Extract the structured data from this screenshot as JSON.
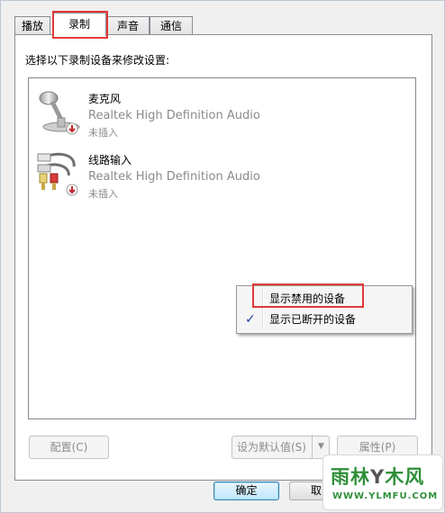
{
  "tabs": [
    {
      "label": "播放"
    },
    {
      "label": "录制"
    },
    {
      "label": "声音"
    },
    {
      "label": "通信"
    }
  ],
  "instruction": "选择以下录制设备来修改设置:",
  "devices": [
    {
      "name": "麦克风",
      "description": "Realtek High Definition Audio",
      "status": "未插入",
      "icon": "microphone-icon"
    },
    {
      "name": "线路输入",
      "description": "Realtek High Definition Audio",
      "status": "未插入",
      "icon": "line-in-cable-icon"
    }
  ],
  "context_menu": {
    "items": [
      {
        "label": "显示禁用的设备",
        "checked": false
      },
      {
        "label": "显示已断开的设备",
        "checked": true
      }
    ]
  },
  "buttons": {
    "configure": "配置(C)",
    "set_default": "设为默认值(S)",
    "properties": "属性(P)",
    "ok": "确定",
    "cancel": "取"
  },
  "watermark": {
    "title_left": "雨林",
    "title_mid": "Y",
    "title_right": "木风",
    "url": "WWW.YLMFU.COM"
  },
  "colors": {
    "highlight_box": "#e0393a",
    "checkmark": "#1b3ea3",
    "disabled_text": "#8a8a8a"
  }
}
